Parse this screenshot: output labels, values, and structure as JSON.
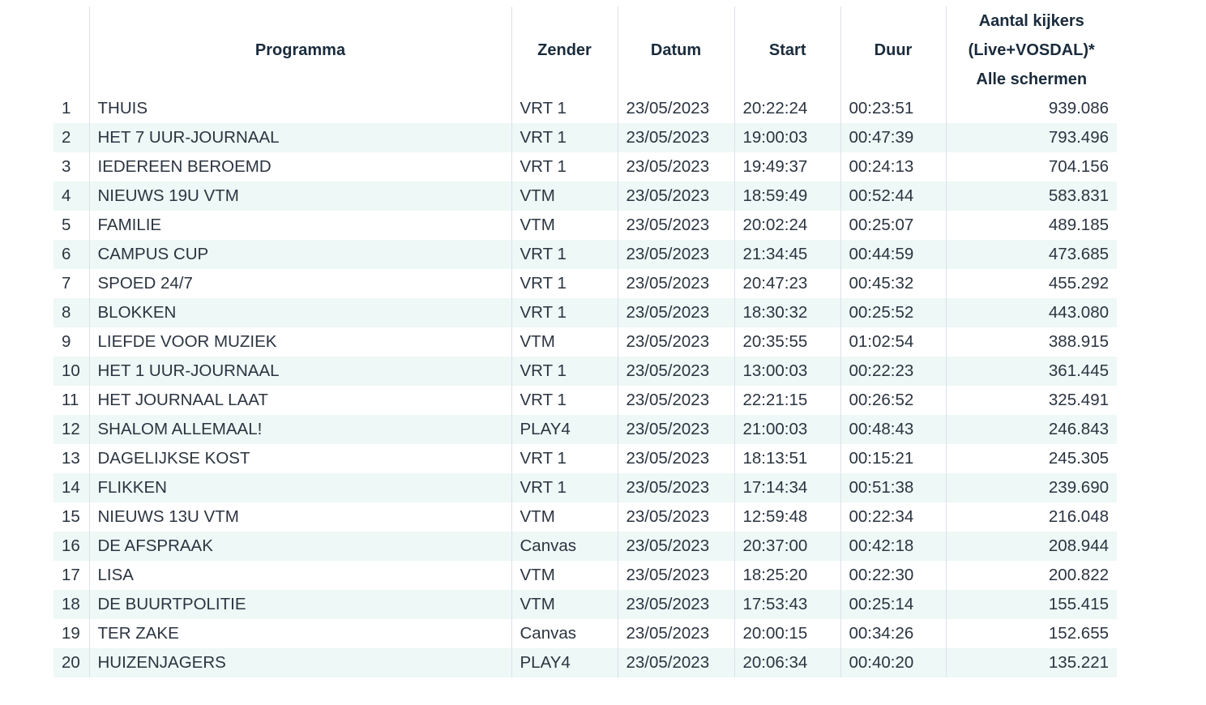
{
  "table": {
    "headers": {
      "rank": "",
      "programma": "Programma",
      "zender": "Zender",
      "datum": "Datum",
      "start": "Start",
      "duur": "Duur",
      "kijkers_line1": "Aantal kijkers",
      "kijkers_line2": "(Live+VOSDAL)*",
      "kijkers_line3": "Alle schermen"
    },
    "rows": [
      {
        "rank": "1",
        "programma": "THUIS",
        "zender": "VRT 1",
        "datum": "23/05/2023",
        "start": "20:22:24",
        "duur": "00:23:51",
        "kijkers": "939.086"
      },
      {
        "rank": "2",
        "programma": "HET 7 UUR-JOURNAAL",
        "zender": "VRT 1",
        "datum": "23/05/2023",
        "start": "19:00:03",
        "duur": "00:47:39",
        "kijkers": "793.496"
      },
      {
        "rank": "3",
        "programma": "IEDEREEN BEROEMD",
        "zender": "VRT 1",
        "datum": "23/05/2023",
        "start": "19:49:37",
        "duur": "00:24:13",
        "kijkers": "704.156"
      },
      {
        "rank": "4",
        "programma": "NIEUWS 19U VTM",
        "zender": "VTM",
        "datum": "23/05/2023",
        "start": "18:59:49",
        "duur": "00:52:44",
        "kijkers": "583.831"
      },
      {
        "rank": "5",
        "programma": "FAMILIE",
        "zender": "VTM",
        "datum": "23/05/2023",
        "start": "20:02:24",
        "duur": "00:25:07",
        "kijkers": "489.185"
      },
      {
        "rank": "6",
        "programma": "CAMPUS CUP",
        "zender": "VRT 1",
        "datum": "23/05/2023",
        "start": "21:34:45",
        "duur": "00:44:59",
        "kijkers": "473.685"
      },
      {
        "rank": "7",
        "programma": "SPOED 24/7",
        "zender": "VRT 1",
        "datum": "23/05/2023",
        "start": "20:47:23",
        "duur": "00:45:32",
        "kijkers": "455.292"
      },
      {
        "rank": "8",
        "programma": "BLOKKEN",
        "zender": "VRT 1",
        "datum": "23/05/2023",
        "start": "18:30:32",
        "duur": "00:25:52",
        "kijkers": "443.080"
      },
      {
        "rank": "9",
        "programma": "LIEFDE VOOR MUZIEK",
        "zender": "VTM",
        "datum": "23/05/2023",
        "start": "20:35:55",
        "duur": "01:02:54",
        "kijkers": "388.915"
      },
      {
        "rank": "10",
        "programma": "HET 1 UUR-JOURNAAL",
        "zender": "VRT 1",
        "datum": "23/05/2023",
        "start": "13:00:03",
        "duur": "00:22:23",
        "kijkers": "361.445"
      },
      {
        "rank": "11",
        "programma": "HET JOURNAAL LAAT",
        "zender": "VRT 1",
        "datum": "23/05/2023",
        "start": "22:21:15",
        "duur": "00:26:52",
        "kijkers": "325.491"
      },
      {
        "rank": "12",
        "programma": "SHALOM ALLEMAAL!",
        "zender": "PLAY4",
        "datum": "23/05/2023",
        "start": "21:00:03",
        "duur": "00:48:43",
        "kijkers": "246.843"
      },
      {
        "rank": "13",
        "programma": "DAGELIJKSE KOST",
        "zender": "VRT 1",
        "datum": "23/05/2023",
        "start": "18:13:51",
        "duur": "00:15:21",
        "kijkers": "245.305"
      },
      {
        "rank": "14",
        "programma": "FLIKKEN",
        "zender": "VRT 1",
        "datum": "23/05/2023",
        "start": "17:14:34",
        "duur": "00:51:38",
        "kijkers": "239.690"
      },
      {
        "rank": "15",
        "programma": "NIEUWS 13U VTM",
        "zender": "VTM",
        "datum": "23/05/2023",
        "start": "12:59:48",
        "duur": "00:22:34",
        "kijkers": "216.048"
      },
      {
        "rank": "16",
        "programma": "DE AFSPRAAK",
        "zender": "Canvas",
        "datum": "23/05/2023",
        "start": "20:37:00",
        "duur": "00:42:18",
        "kijkers": "208.944"
      },
      {
        "rank": "17",
        "programma": "LISA",
        "zender": "VTM",
        "datum": "23/05/2023",
        "start": "18:25:20",
        "duur": "00:22:30",
        "kijkers": "200.822"
      },
      {
        "rank": "18",
        "programma": "DE BUURTPOLITIE",
        "zender": "VTM",
        "datum": "23/05/2023",
        "start": "17:53:43",
        "duur": "00:25:14",
        "kijkers": "155.415"
      },
      {
        "rank": "19",
        "programma": "TER ZAKE",
        "zender": "Canvas",
        "datum": "23/05/2023",
        "start": "20:00:15",
        "duur": "00:34:26",
        "kijkers": "152.655"
      },
      {
        "rank": "20",
        "programma": "HUIZENJAGERS",
        "zender": "PLAY4",
        "datum": "23/05/2023",
        "start": "20:06:34",
        "duur": "00:40:20",
        "kijkers": "135.221"
      }
    ],
    "colors": {
      "stripe": "#eef8f6",
      "divider": "#dde0ea",
      "text": "#2b3440",
      "header_text": "#1a2b3c"
    }
  }
}
